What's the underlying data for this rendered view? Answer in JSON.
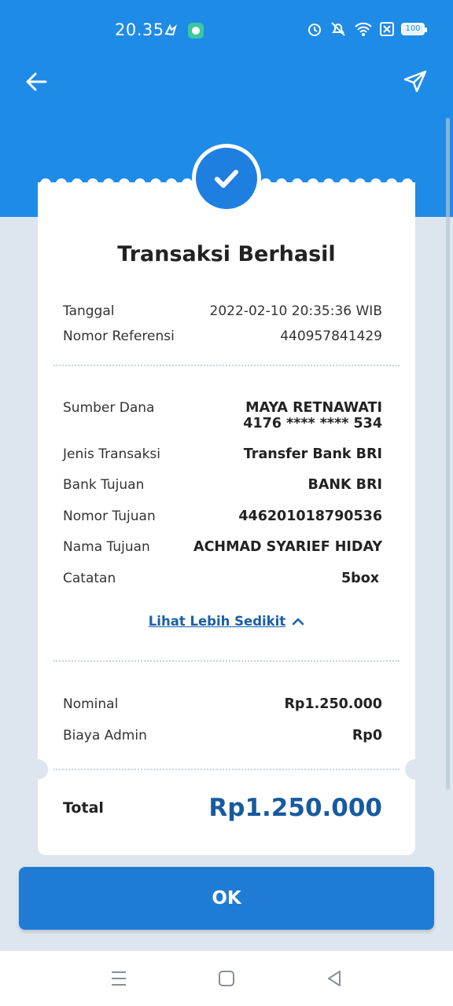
{
  "status_bar": {
    "time": "20.35",
    "battery": "100"
  },
  "header": {
    "back_icon": "arrow-left-icon",
    "share_icon": "send-icon"
  },
  "receipt": {
    "title": "Transaksi Berhasil",
    "meta": [
      {
        "label": "Tanggal",
        "value": "2022-02-10 20:35:36 WIB"
      },
      {
        "label": "Nomor Referensi",
        "value": "440957841429"
      }
    ],
    "details": {
      "source_label": "Sumber Dana",
      "source_name": "MAYA RETNAWATI",
      "source_account": "4176 **** **** 534",
      "items": [
        {
          "label": "Jenis Transaksi",
          "value": "Transfer Bank BRI"
        },
        {
          "label": "Bank Tujuan",
          "value": "BANK BRI"
        },
        {
          "label": "Nomor Tujuan",
          "value": "446201018790536"
        },
        {
          "label": "Nama Tujuan",
          "value": "ACHMAD SYARIEF HIDAY"
        },
        {
          "label": "Catatan",
          "value": "5box"
        }
      ]
    },
    "toggle_label": "Lihat Lebih Sedikit",
    "amounts": [
      {
        "label": "Nominal",
        "value": "Rp1.250.000"
      },
      {
        "label": "Biaya Admin",
        "value": "Rp0"
      }
    ],
    "total_label": "Total",
    "total_value": "Rp1.250.000"
  },
  "ok_button": "OK",
  "colors": {
    "header_blue": "#1e8be6",
    "button_blue": "#1f7bd4",
    "total_blue": "#175aa0",
    "link_blue": "#1b5fa6",
    "background": "#dde6ee"
  }
}
